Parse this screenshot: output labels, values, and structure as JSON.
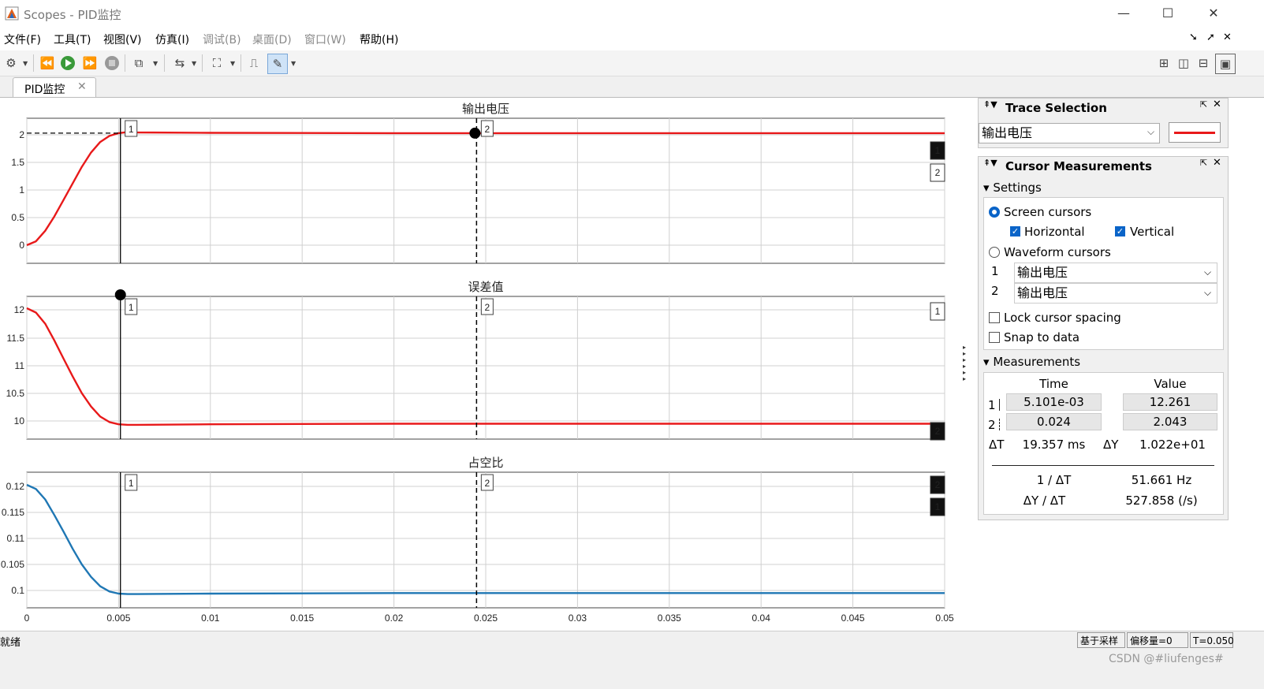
{
  "window": {
    "title": "Scopes - PID监控",
    "icon": "matlab-logo-icon",
    "controls": {
      "minimize": "—",
      "maximize": "☐",
      "close": "✕"
    }
  },
  "menu": [
    "文件(F)",
    "工具(T)",
    "视图(V)",
    "仿真(I)",
    "调试(B)",
    "桌面(D)",
    "窗口(W)",
    "帮助(H)"
  ],
  "tab": {
    "label": "PID监控",
    "close": "✕"
  },
  "colors": {
    "red": "#e8191a",
    "blue": "#1f77b4",
    "selection": "#0a64c8"
  },
  "plots": [
    {
      "title": "输出电压",
      "yticks": [
        "2",
        "1.5",
        "1",
        "0.5",
        "0"
      ]
    },
    {
      "title": "误差值",
      "yticks": [
        "12",
        "11.5",
        "11",
        "10.5",
        "10"
      ]
    },
    {
      "title": "占空比",
      "yticks": [
        "0.12",
        "0.115",
        "0.11",
        "0.105",
        "0.1"
      ]
    }
  ],
  "xticks": [
    "0",
    "0.005",
    "0.01",
    "0.015",
    "0.02",
    "0.025",
    "0.03",
    "0.035",
    "0.04",
    "0.045",
    "0.05"
  ],
  "cursor_labels": {
    "c1": "1",
    "c2": "2"
  },
  "chart_data": [
    {
      "type": "line",
      "title": "输出电压",
      "xlim": [
        0,
        0.05
      ],
      "ylim": [
        -0.2,
        2.2
      ],
      "series": [
        {
          "color": "#e8191a",
          "x": [
            0,
            0.0005,
            0.001,
            0.0015,
            0.002,
            0.0025,
            0.003,
            0.0035,
            0.004,
            0.0045,
            0.005,
            0.0055,
            0.006,
            0.01,
            0.02,
            0.03,
            0.04,
            0.05
          ],
          "y": [
            0,
            0.07,
            0.26,
            0.52,
            0.82,
            1.12,
            1.42,
            1.68,
            1.87,
            1.98,
            2.03,
            2.05,
            2.043,
            2.035,
            2.03,
            2.03,
            2.03,
            2.03
          ]
        }
      ]
    },
    {
      "type": "line",
      "title": "误差值",
      "xlim": [
        0,
        0.05
      ],
      "ylim": [
        9.8,
        12.2
      ],
      "series": [
        {
          "color": "#e8191a",
          "x": [
            0,
            0.0005,
            0.001,
            0.0015,
            0.002,
            0.0025,
            0.003,
            0.0035,
            0.004,
            0.0045,
            0.005,
            0.0055,
            0.006,
            0.01,
            0.02,
            0.03,
            0.04,
            0.05
          ],
          "y": [
            12.03,
            11.95,
            11.75,
            11.45,
            11.12,
            10.8,
            10.5,
            10.26,
            10.08,
            9.98,
            9.94,
            9.93,
            9.93,
            9.94,
            9.95,
            9.95,
            9.95,
            9.95
          ]
        }
      ]
    },
    {
      "type": "line",
      "title": "占空比",
      "xlim": [
        0,
        0.05
      ],
      "ylim": [
        0.098,
        0.122
      ],
      "series": [
        {
          "color": "#1f77b4",
          "x": [
            0,
            0.0005,
            0.001,
            0.0015,
            0.002,
            0.0025,
            0.003,
            0.0035,
            0.004,
            0.0045,
            0.005,
            0.0055,
            0.006,
            0.01,
            0.02,
            0.03,
            0.04,
            0.05
          ],
          "y": [
            0.1203,
            0.1195,
            0.1175,
            0.1145,
            0.1113,
            0.108,
            0.105,
            0.1026,
            0.1008,
            0.0998,
            0.0994,
            0.0993,
            0.0993,
            0.0994,
            0.0995,
            0.0995,
            0.0995,
            0.0995
          ]
        }
      ]
    }
  ],
  "cursors": {
    "t1": 0.0051,
    "t2": 0.0245
  },
  "trace_selection": {
    "title": "Trace Selection",
    "selected": "输出电压"
  },
  "cursor_measurements": {
    "title": "Cursor Measurements",
    "settings_label": "Settings",
    "screen_cursors": "Screen cursors",
    "horizontal": "Horizontal",
    "vertical": "Vertical",
    "waveform_cursors": "Waveform cursors",
    "wave1_index": "1",
    "wave1": "输出电压",
    "wave2_index": "2",
    "wave2": "输出电压",
    "lock_spacing": "Lock cursor spacing",
    "snap": "Snap to data",
    "measurements_label": "Measurements",
    "time_header": "Time",
    "value_header": "Value",
    "row1_index": "1",
    "row1_time": "5.101e-03",
    "row1_value": "12.261",
    "row2_index": "2",
    "row2_time": "0.024",
    "row2_value": "2.043",
    "dT_label": "ΔT",
    "dT": "19.357 ms",
    "dY_label": "ΔY",
    "dY": "1.022e+01",
    "inv_dT_label": "1 / ΔT",
    "inv_dT": "51.661 Hz",
    "slope_label": "ΔY / ΔT",
    "slope": "527.858 (/s)"
  },
  "status": {
    "ready": "就绪",
    "mode": "基于采样",
    "offset": "偏移量=0",
    "time": "T=0.050"
  },
  "watermark": "CSDN @#liufenges#"
}
